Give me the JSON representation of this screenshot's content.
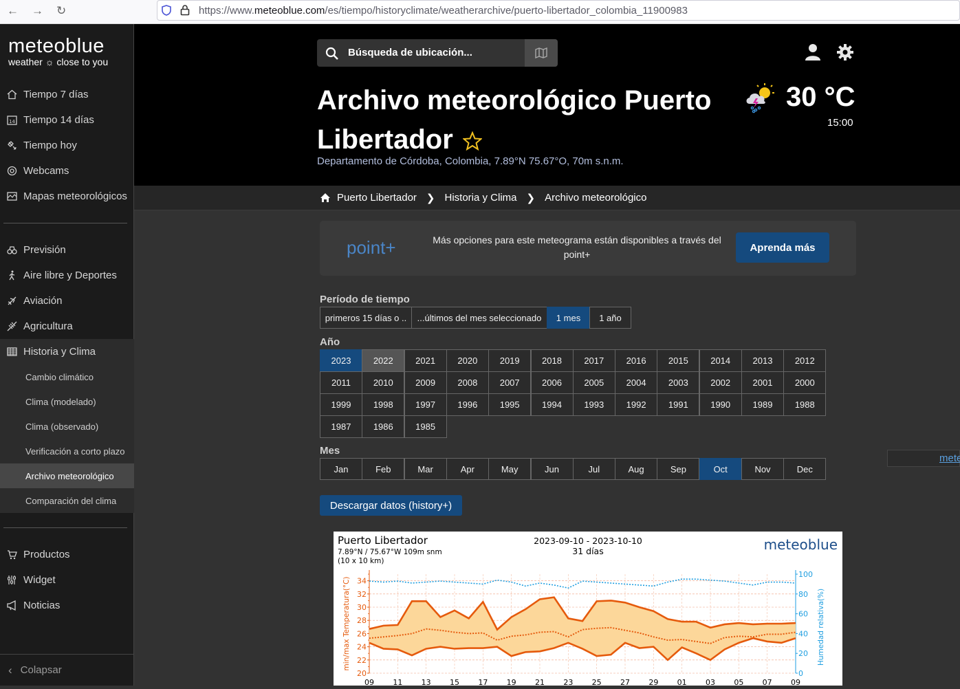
{
  "browser": {
    "url_prefix": "https://www.",
    "url_domain": "meteoblue.com",
    "url_path": "/es/tiempo/historyclimate/weatherarchive/puerto-libertador_colombia_11900983"
  },
  "logo": {
    "name": "meteoblue",
    "tagline": "weather ☼ close to you"
  },
  "sidebar": {
    "top": [
      {
        "label": "Tiempo 7 días",
        "icon": "home-icon"
      },
      {
        "label": "Tiempo 14 días",
        "icon": "calendar-14-icon"
      },
      {
        "label": "Tiempo hoy",
        "icon": "satellite-icon"
      },
      {
        "label": "Webcams",
        "icon": "webcam-icon"
      },
      {
        "label": "Mapas meteorológicos",
        "icon": "map-icon"
      }
    ],
    "middle": [
      {
        "label": "Previsión",
        "icon": "binoculars-icon"
      },
      {
        "label": "Aire libre y Deportes",
        "icon": "hiker-icon"
      },
      {
        "label": "Aviación",
        "icon": "plane-icon"
      },
      {
        "label": "Agricultura",
        "icon": "wheat-icon"
      },
      {
        "label": "Historia y Clima",
        "icon": "table-icon"
      }
    ],
    "sub": [
      "Cambio climático",
      "Clima (modelado)",
      "Clima (observado)",
      "Verificación a corto plazo",
      "Archivo meteorológico",
      "Comparación del clima"
    ],
    "bottom": [
      {
        "label": "Productos",
        "icon": "cart-icon"
      },
      {
        "label": "Widget",
        "icon": "widget-icon"
      },
      {
        "label": "Noticias",
        "icon": "megaphone-icon"
      }
    ],
    "collapse": "Colapsar"
  },
  "header": {
    "search_placeholder": "Búsqueda de ubicación...",
    "title": "Archivo meteorológico Puerto Libertador",
    "subtitle": "Departamento de Córdoba, Colombia, 7.89°N 75.67°O, 70m s.n.m.",
    "temperature": "30 °C",
    "time": "15:00"
  },
  "breadcrumb": [
    "Puerto Libertador",
    "Historia y Clima",
    "Archivo meteorológico"
  ],
  "promo": {
    "brand": "point+",
    "text": "Más opciones para este meteograma están disponibles a través del point+",
    "button": "Aprenda más"
  },
  "period": {
    "label": "Período de tiempo",
    "options": [
      "primeros 15 días o ..",
      "...últimos del mes seleccionado",
      "1 mes",
      "1 año"
    ],
    "selected": "1 mes"
  },
  "year": {
    "label": "Año",
    "options": [
      "2023",
      "2022",
      "2021",
      "2020",
      "2019",
      "2018",
      "2017",
      "2016",
      "2015",
      "2014",
      "2013",
      "2012",
      "2011",
      "2010",
      "2009",
      "2008",
      "2007",
      "2006",
      "2005",
      "2004",
      "2003",
      "2002",
      "2001",
      "2000",
      "1999",
      "1998",
      "1997",
      "1996",
      "1995",
      "1994",
      "1993",
      "1992",
      "1991",
      "1990",
      "1989",
      "1988",
      "1987",
      "1986",
      "1985"
    ],
    "selected": "2023",
    "hover": "2022"
  },
  "month": {
    "label": "Mes",
    "options": [
      "Jan",
      "Feb",
      "Mar",
      "Apr",
      "May",
      "Jun",
      "Jul",
      "Aug",
      "Sep",
      "Oct",
      "Nov",
      "Dec"
    ],
    "selected": "Oct"
  },
  "download": "Descargar datos (history+)",
  "side_link": "mete",
  "chart_data": {
    "type": "line",
    "title": "Puerto Libertador",
    "location_info": "7.89°N / 75.67°W  109m snm",
    "resolution": "(10 x 10 km)",
    "period": "2023-09-10 - 2023-10-10",
    "days": "31 días",
    "brand": "meteoblue",
    "ylabel": "min/max Temperatura(°C)",
    "ylabel_right": "Humedad relativa(%)",
    "ylim": [
      20,
      35
    ],
    "yticks": [
      20,
      22,
      24,
      26,
      28,
      30,
      32,
      34
    ],
    "ylim_right": [
      0,
      100
    ],
    "yticks_right": [
      0,
      20,
      40,
      60,
      80,
      100
    ],
    "x_ticks": [
      "09",
      "11",
      "13",
      "15",
      "17",
      "19",
      "21",
      "23",
      "25",
      "27",
      "29",
      "01",
      "03",
      "05",
      "07",
      "09"
    ],
    "x_tick_day_index": [
      0,
      2,
      4,
      6,
      8,
      10,
      12,
      14,
      16,
      18,
      20,
      22,
      24,
      26,
      28,
      30
    ],
    "series": [
      {
        "values": [
          26.7,
          27.2,
          27.3,
          30.9,
          30.9,
          28.5,
          29.5,
          28.3,
          30.8,
          26.6,
          28.5,
          29.7,
          31.2,
          31.5,
          28.3,
          27.9,
          30.9,
          31.0,
          30.7,
          30.0,
          29.4,
          28.2,
          27.8,
          27.8,
          26.9,
          27.4,
          27.6,
          27.4,
          27.5,
          27.5,
          27.6
        ],
        "color": "#e55a0c"
      },
      {
        "values": [
          24.6,
          23.7,
          23.6,
          22.7,
          23.7,
          24.0,
          23.7,
          23.8,
          23.8,
          24.0,
          22.6,
          23.2,
          23.3,
          23.8,
          24.6,
          23.7,
          22.6,
          22.8,
          24.6,
          23.8,
          24.0,
          22.0,
          23.9,
          23.0,
          22.0,
          23.6,
          24.6,
          25.3,
          24.8,
          24.6,
          25.3
        ],
        "color": "#e55a0c"
      },
      {
        "values": [
          25.3,
          25.5,
          25.7,
          26.0,
          26.7,
          26.5,
          26.2,
          26.0,
          26.1,
          25.0,
          25.6,
          25.8,
          26.2,
          26.3,
          25.5,
          26.6,
          26.8,
          26.9,
          26.5,
          26.1,
          25.5,
          25.0,
          25.1,
          24.8,
          24.5,
          25.4,
          25.6,
          25.5,
          25.9,
          25.9,
          26.2
        ],
        "color": "#e55a0c"
      },
      {
        "values": [
          93,
          92,
          93,
          91,
          92,
          93,
          92,
          91,
          90,
          94,
          92,
          88,
          91,
          89,
          86,
          93,
          92,
          91,
          90,
          89,
          88,
          92,
          95,
          95,
          94,
          93,
          91,
          89,
          92,
          92,
          91
        ],
        "color": "#1e9ee0"
      }
    ]
  }
}
